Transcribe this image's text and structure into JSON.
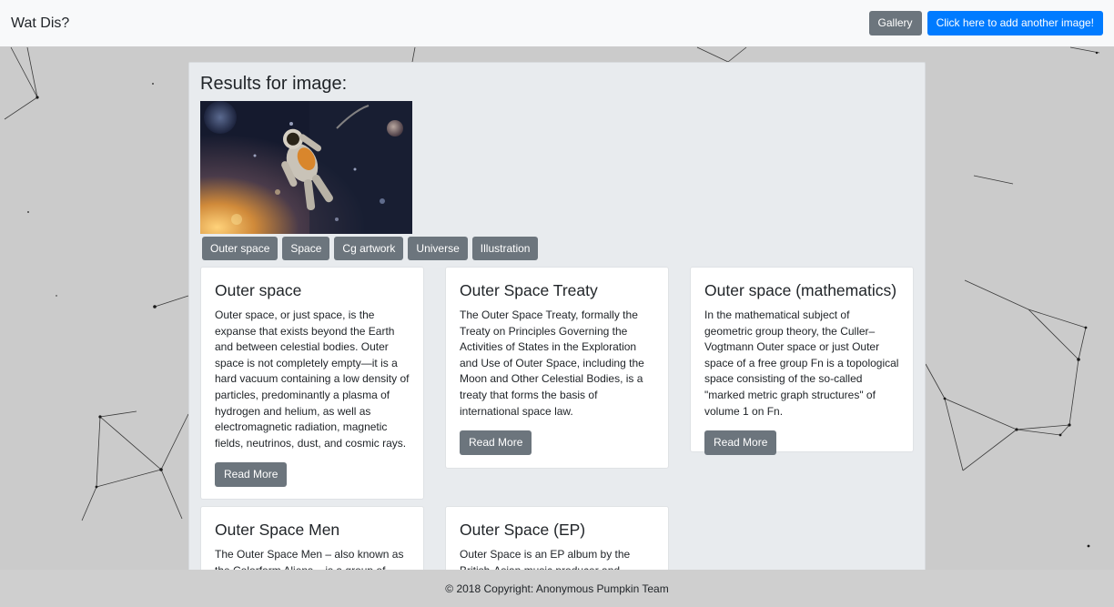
{
  "navbar": {
    "brand": "Wat Dis?",
    "gallery_label": "Gallery",
    "add_image_label": "Click here to add another image!"
  },
  "results": {
    "title": "Results for image:",
    "tags": [
      "Outer space",
      "Space",
      "Cg artwork",
      "Universe",
      "Illustration"
    ]
  },
  "cards": [
    {
      "title": "Outer space",
      "text": "Outer space, or just space, is the expanse that exists beyond the Earth and between celestial bodies. Outer space is not completely empty—it is a hard vacuum containing a low density of particles, predominantly a plasma of hydrogen and helium, as well as electromagnetic radiation, magnetic fields, neutrinos, dust, and cosmic rays.",
      "button": "Read More"
    },
    {
      "title": "Outer Space Treaty",
      "text": "The Outer Space Treaty, formally the Treaty on Principles Governing the Activities of States in the Exploration and Use of Outer Space, including the Moon and Other Celestial Bodies, is a treaty that forms the basis of international space law.",
      "button": "Read More"
    },
    {
      "title": "Outer space (mathematics)",
      "text": "In the mathematical subject of geometric group theory, the Culler–Vogtmann Outer space or just Outer space of a free group Fn is a topological space consisting of the so-called \"marked metric graph structures\" of volume 1 on Fn.",
      "button": "Read More"
    },
    {
      "title": "Outer Space Men",
      "text": "The Outer Space Men – also known as the Colorform Aliens – is a group of"
    },
    {
      "title": "Outer Space (EP)",
      "text": "Outer Space is an EP album by the British-Asian music producer and vocalist"
    }
  ],
  "footer": {
    "copyright": "© 2018 Copyright: Anonymous Pumpkin Team"
  }
}
